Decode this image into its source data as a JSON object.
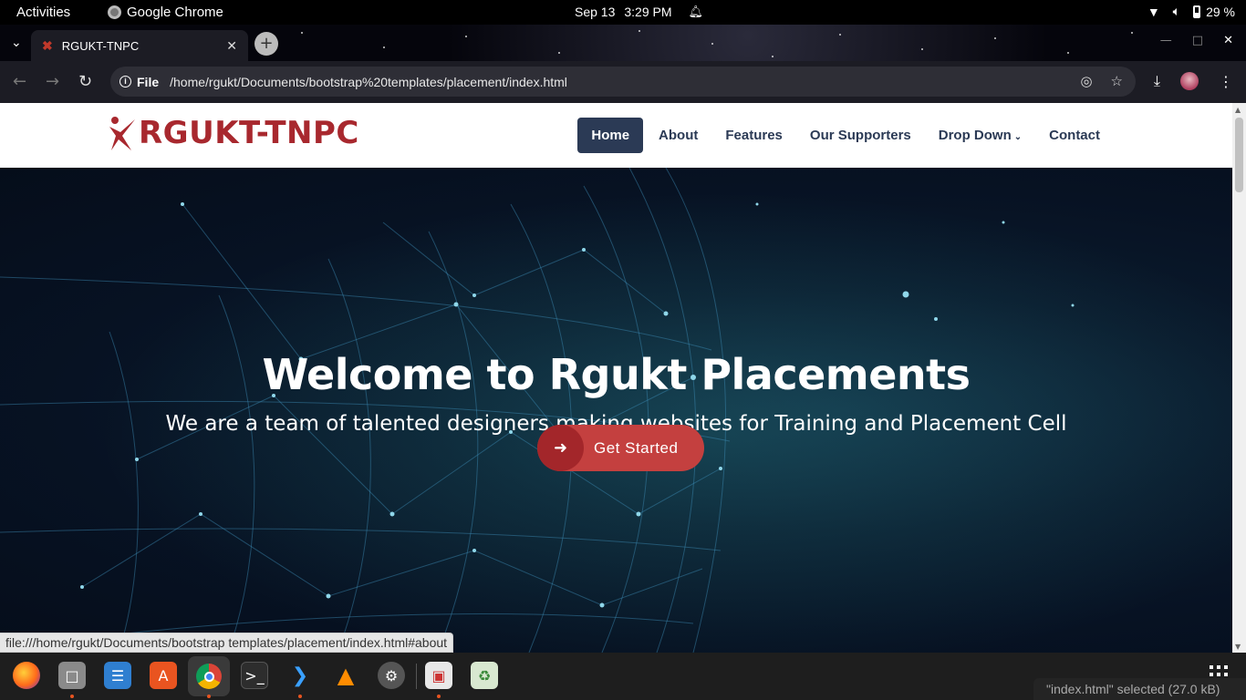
{
  "system_bar": {
    "activities": "Activities",
    "app_name": "Google Chrome",
    "date": "Sep 13",
    "time": "3:29 PM",
    "battery": "29 %"
  },
  "browser": {
    "tab_title": "RGUKT-TNPC",
    "address_scheme": "File",
    "address_url": "/home/rgukt/Documents/bootstrap%20templates/placement/index.html",
    "status_url": "file:///home/rgukt/Documents/bootstrap templates/placement/index.html#about"
  },
  "site": {
    "brand": "RGUKT-TNPC",
    "nav": [
      {
        "label": "Home",
        "active": true
      },
      {
        "label": "About"
      },
      {
        "label": "Features"
      },
      {
        "label": "Our Supporters"
      },
      {
        "label": "Drop Down",
        "dropdown": true
      },
      {
        "label": "Contact"
      }
    ],
    "hero_title": "Welcome to Rgukt Placements",
    "hero_subtitle": "We are a team of talented designers making websites for Training and Placement Cell",
    "cta_label": "Get Started"
  },
  "notification": "\"index.html\" selected (27.0 kB)",
  "dock_apps": [
    "firefox-icon",
    "files-icon",
    "text-editor-icon",
    "app-center-icon",
    "chrome-icon",
    "terminal-icon",
    "vscode-icon",
    "vlc-icon",
    "settings-icon",
    "screenshot-icon",
    "trash-icon"
  ],
  "colors": {
    "brand_red": "#a8282e",
    "nav_navy": "#2b3a55",
    "cta_red": "#c4403f",
    "cta_dark": "#a3262a"
  }
}
